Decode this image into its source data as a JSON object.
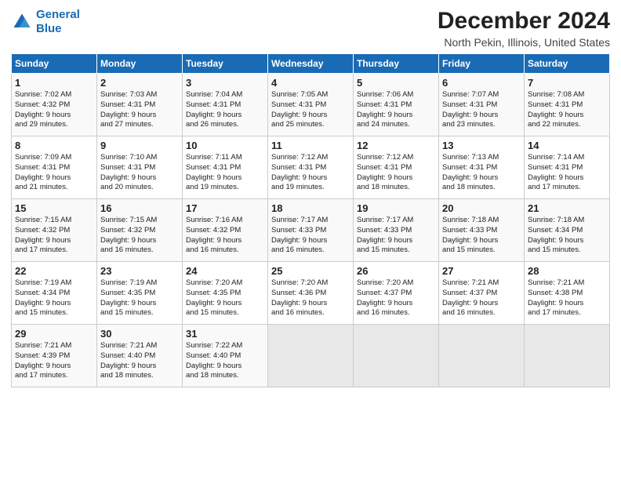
{
  "header": {
    "logo_line1": "General",
    "logo_line2": "Blue",
    "month": "December 2024",
    "location": "North Pekin, Illinois, United States"
  },
  "weekdays": [
    "Sunday",
    "Monday",
    "Tuesday",
    "Wednesday",
    "Thursday",
    "Friday",
    "Saturday"
  ],
  "weeks": [
    [
      {
        "day": "1",
        "lines": [
          "Sunrise: 7:02 AM",
          "Sunset: 4:32 PM",
          "Daylight: 9 hours",
          "and 29 minutes."
        ]
      },
      {
        "day": "2",
        "lines": [
          "Sunrise: 7:03 AM",
          "Sunset: 4:31 PM",
          "Daylight: 9 hours",
          "and 27 minutes."
        ]
      },
      {
        "day": "3",
        "lines": [
          "Sunrise: 7:04 AM",
          "Sunset: 4:31 PM",
          "Daylight: 9 hours",
          "and 26 minutes."
        ]
      },
      {
        "day": "4",
        "lines": [
          "Sunrise: 7:05 AM",
          "Sunset: 4:31 PM",
          "Daylight: 9 hours",
          "and 25 minutes."
        ]
      },
      {
        "day": "5",
        "lines": [
          "Sunrise: 7:06 AM",
          "Sunset: 4:31 PM",
          "Daylight: 9 hours",
          "and 24 minutes."
        ]
      },
      {
        "day": "6",
        "lines": [
          "Sunrise: 7:07 AM",
          "Sunset: 4:31 PM",
          "Daylight: 9 hours",
          "and 23 minutes."
        ]
      },
      {
        "day": "7",
        "lines": [
          "Sunrise: 7:08 AM",
          "Sunset: 4:31 PM",
          "Daylight: 9 hours",
          "and 22 minutes."
        ]
      }
    ],
    [
      {
        "day": "8",
        "lines": [
          "Sunrise: 7:09 AM",
          "Sunset: 4:31 PM",
          "Daylight: 9 hours",
          "and 21 minutes."
        ]
      },
      {
        "day": "9",
        "lines": [
          "Sunrise: 7:10 AM",
          "Sunset: 4:31 PM",
          "Daylight: 9 hours",
          "and 20 minutes."
        ]
      },
      {
        "day": "10",
        "lines": [
          "Sunrise: 7:11 AM",
          "Sunset: 4:31 PM",
          "Daylight: 9 hours",
          "and 19 minutes."
        ]
      },
      {
        "day": "11",
        "lines": [
          "Sunrise: 7:12 AM",
          "Sunset: 4:31 PM",
          "Daylight: 9 hours",
          "and 19 minutes."
        ]
      },
      {
        "day": "12",
        "lines": [
          "Sunrise: 7:12 AM",
          "Sunset: 4:31 PM",
          "Daylight: 9 hours",
          "and 18 minutes."
        ]
      },
      {
        "day": "13",
        "lines": [
          "Sunrise: 7:13 AM",
          "Sunset: 4:31 PM",
          "Daylight: 9 hours",
          "and 18 minutes."
        ]
      },
      {
        "day": "14",
        "lines": [
          "Sunrise: 7:14 AM",
          "Sunset: 4:31 PM",
          "Daylight: 9 hours",
          "and 17 minutes."
        ]
      }
    ],
    [
      {
        "day": "15",
        "lines": [
          "Sunrise: 7:15 AM",
          "Sunset: 4:32 PM",
          "Daylight: 9 hours",
          "and 17 minutes."
        ]
      },
      {
        "day": "16",
        "lines": [
          "Sunrise: 7:15 AM",
          "Sunset: 4:32 PM",
          "Daylight: 9 hours",
          "and 16 minutes."
        ]
      },
      {
        "day": "17",
        "lines": [
          "Sunrise: 7:16 AM",
          "Sunset: 4:32 PM",
          "Daylight: 9 hours",
          "and 16 minutes."
        ]
      },
      {
        "day": "18",
        "lines": [
          "Sunrise: 7:17 AM",
          "Sunset: 4:33 PM",
          "Daylight: 9 hours",
          "and 16 minutes."
        ]
      },
      {
        "day": "19",
        "lines": [
          "Sunrise: 7:17 AM",
          "Sunset: 4:33 PM",
          "Daylight: 9 hours",
          "and 15 minutes."
        ]
      },
      {
        "day": "20",
        "lines": [
          "Sunrise: 7:18 AM",
          "Sunset: 4:33 PM",
          "Daylight: 9 hours",
          "and 15 minutes."
        ]
      },
      {
        "day": "21",
        "lines": [
          "Sunrise: 7:18 AM",
          "Sunset: 4:34 PM",
          "Daylight: 9 hours",
          "and 15 minutes."
        ]
      }
    ],
    [
      {
        "day": "22",
        "lines": [
          "Sunrise: 7:19 AM",
          "Sunset: 4:34 PM",
          "Daylight: 9 hours",
          "and 15 minutes."
        ]
      },
      {
        "day": "23",
        "lines": [
          "Sunrise: 7:19 AM",
          "Sunset: 4:35 PM",
          "Daylight: 9 hours",
          "and 15 minutes."
        ]
      },
      {
        "day": "24",
        "lines": [
          "Sunrise: 7:20 AM",
          "Sunset: 4:35 PM",
          "Daylight: 9 hours",
          "and 15 minutes."
        ]
      },
      {
        "day": "25",
        "lines": [
          "Sunrise: 7:20 AM",
          "Sunset: 4:36 PM",
          "Daylight: 9 hours",
          "and 16 minutes."
        ]
      },
      {
        "day": "26",
        "lines": [
          "Sunrise: 7:20 AM",
          "Sunset: 4:37 PM",
          "Daylight: 9 hours",
          "and 16 minutes."
        ]
      },
      {
        "day": "27",
        "lines": [
          "Sunrise: 7:21 AM",
          "Sunset: 4:37 PM",
          "Daylight: 9 hours",
          "and 16 minutes."
        ]
      },
      {
        "day": "28",
        "lines": [
          "Sunrise: 7:21 AM",
          "Sunset: 4:38 PM",
          "Daylight: 9 hours",
          "and 17 minutes."
        ]
      }
    ],
    [
      {
        "day": "29",
        "lines": [
          "Sunrise: 7:21 AM",
          "Sunset: 4:39 PM",
          "Daylight: 9 hours",
          "and 17 minutes."
        ]
      },
      {
        "day": "30",
        "lines": [
          "Sunrise: 7:21 AM",
          "Sunset: 4:40 PM",
          "Daylight: 9 hours",
          "and 18 minutes."
        ]
      },
      {
        "day": "31",
        "lines": [
          "Sunrise: 7:22 AM",
          "Sunset: 4:40 PM",
          "Daylight: 9 hours",
          "and 18 minutes."
        ]
      },
      {
        "day": "",
        "lines": []
      },
      {
        "day": "",
        "lines": []
      },
      {
        "day": "",
        "lines": []
      },
      {
        "day": "",
        "lines": []
      }
    ]
  ]
}
